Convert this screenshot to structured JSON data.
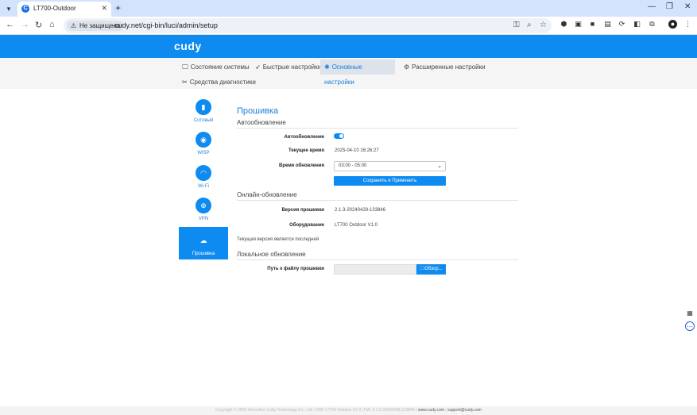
{
  "browser": {
    "tab_title": "LT700-Outdoor",
    "favicon_letter": "C",
    "security_label": "Не защищено",
    "url": "cudy.net/cgi-bin/luci/admin/setup"
  },
  "header": {
    "logo": "cudy"
  },
  "menu": {
    "items": [
      {
        "label": "Состояние системы",
        "icon": "monitor-icon"
      },
      {
        "label": "Быстрые настройки",
        "icon": "rocket-icon"
      },
      {
        "label": "Основные настройки",
        "icon": "gear-icon",
        "active": true
      },
      {
        "label": "Расширенные настройки",
        "icon": "wrench-icon"
      },
      {
        "label": "Средства диагностики",
        "icon": "tools-icon"
      }
    ]
  },
  "sidebar": {
    "items": [
      {
        "label": "Сотовый",
        "icon": "signal-bars-icon"
      },
      {
        "label": "WISP",
        "icon": "antenna-icon"
      },
      {
        "label": "Wi-Fi",
        "icon": "wifi-icon"
      },
      {
        "label": "VPN",
        "icon": "globe-icon"
      },
      {
        "label": "Прошивка",
        "icon": "cloud-upload-icon",
        "active": true
      }
    ]
  },
  "page": {
    "title": "Прошивка",
    "auto_update": {
      "section_title": "Автообновление",
      "auto_label": "Автообновление",
      "auto_enabled": true,
      "time_label": "Текущее время",
      "time_value": "2025-04-10 16:26:27",
      "update_time_label": "Время обновления",
      "update_time_value": "03:00 - 05:00",
      "save_label": "Сохранить и Применить"
    },
    "online_update": {
      "section_title": "Онлайн-обновление",
      "fw_label": "Версия прошивки",
      "fw_value": "2.1.3-20240428-133846",
      "hw_label": "Оборудование",
      "hw_value": "LT700 Outdoor V1.0",
      "note": "Текущая версия является последней"
    },
    "local_update": {
      "section_title": "Локальное обновление",
      "path_label": "Путь к файлу прошивки",
      "browse_label": "Обзор..."
    }
  },
  "footer": {
    "copyright": "Copyright © 2024 Shenzhen Cudy Technology Co., Ltd.",
    "hw": "HW: LT700 Outdoor V1.0",
    "fw": "FW: 2.1.3-20240428-133846",
    "site": "www.cudy.com",
    "support": "support@cudy.com"
  },
  "colors": {
    "brand": "#0e8bf0",
    "accent_text": "#1a7fd8"
  }
}
